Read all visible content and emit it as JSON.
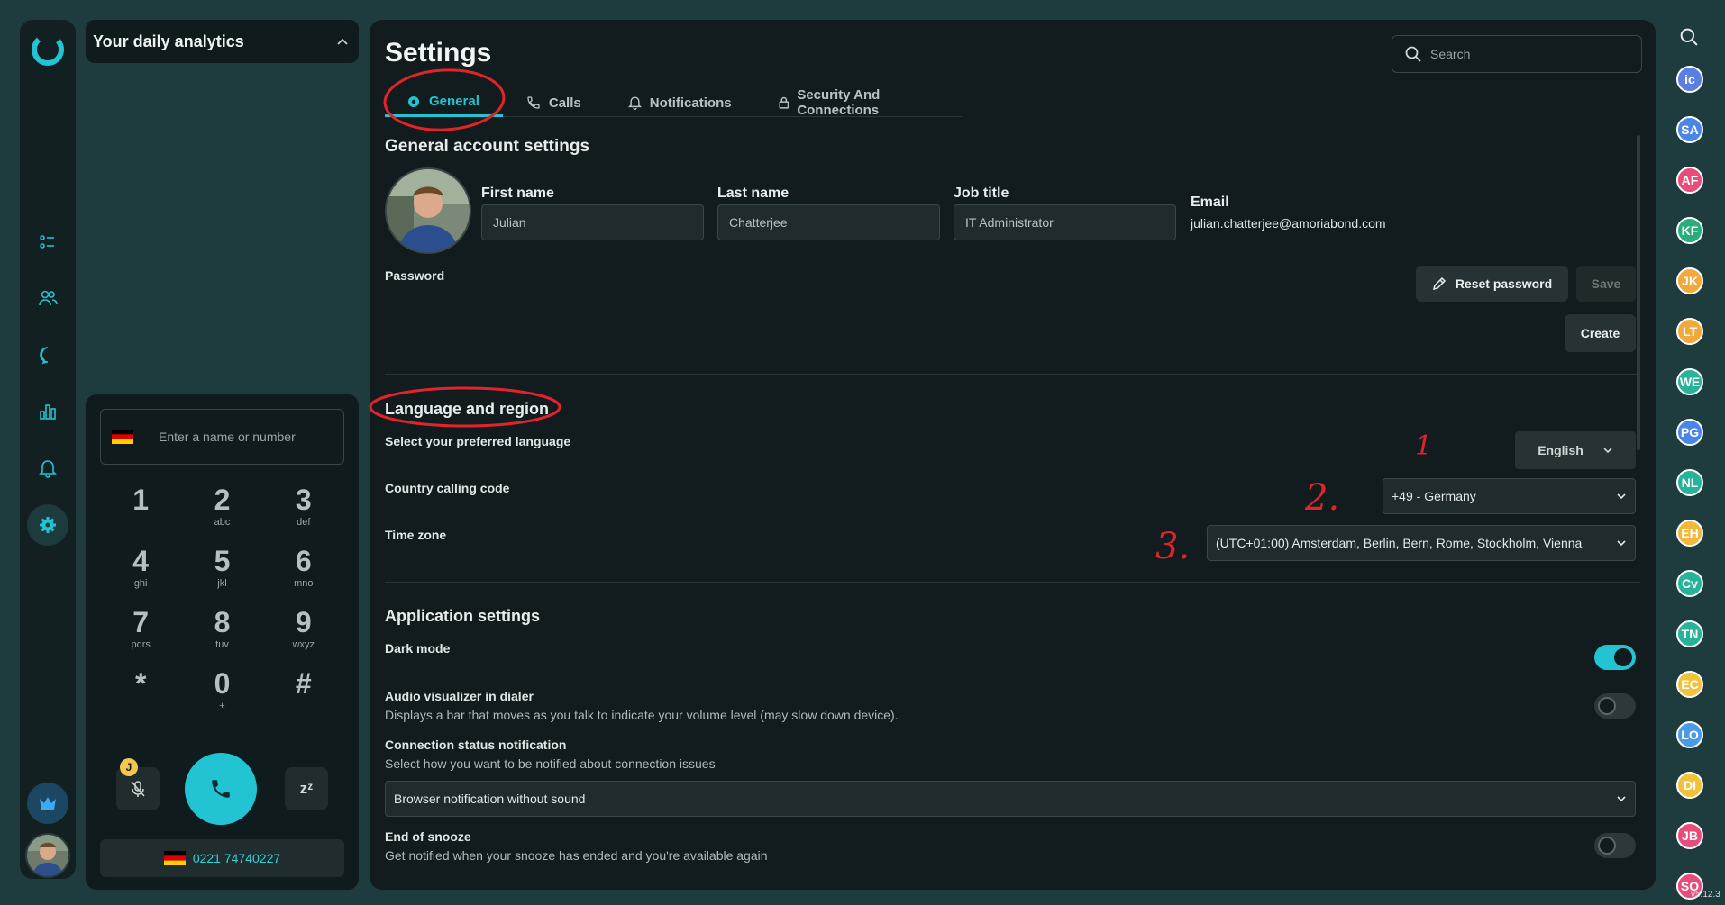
{
  "analytics": {
    "title": "Your daily analytics"
  },
  "dialer": {
    "placeholder": "Enter a name or number",
    "keys": [
      {
        "num": "1",
        "letters": ""
      },
      {
        "num": "2",
        "letters": "abc"
      },
      {
        "num": "3",
        "letters": "def"
      },
      {
        "num": "4",
        "letters": "ghi"
      },
      {
        "num": "5",
        "letters": "jkl"
      },
      {
        "num": "6",
        "letters": "mno"
      },
      {
        "num": "7",
        "letters": "pqrs"
      },
      {
        "num": "8",
        "letters": "tuv"
      },
      {
        "num": "9",
        "letters": "wxyz"
      },
      {
        "num": "*",
        "letters": ""
      },
      {
        "num": "0",
        "letters": "+"
      },
      {
        "num": "#",
        "letters": ""
      }
    ],
    "badge": "J",
    "snooze_label": "zᶻ",
    "my_number": "0221 74740227"
  },
  "settings": {
    "title": "Settings",
    "search_placeholder": "Search",
    "tabs": [
      {
        "label": "General",
        "icon": "gear-icon"
      },
      {
        "label": "Calls",
        "icon": "phone-icon"
      },
      {
        "label": "Notifications",
        "icon": "bell-icon"
      },
      {
        "label": "Security And Connections",
        "icon": "lock-icon"
      }
    ],
    "general": {
      "heading": "General account settings",
      "first_name_label": "First name",
      "first_name": "Julian",
      "last_name_label": "Last name",
      "last_name": "Chatterjee",
      "job_title_label": "Job title",
      "job_title": "IT Administrator",
      "email_label": "Email",
      "email": "julian.chatterjee@amoriabond.com",
      "password_label": "Password",
      "reset_password": "Reset password",
      "save": "Save",
      "create": "Create"
    },
    "language": {
      "heading": "Language and region",
      "language_label": "Select your preferred language",
      "language_value": "English",
      "country_label": "Country calling code",
      "country_value": "+49 - Germany",
      "timezone_label": "Time zone",
      "timezone_value": "(UTC+01:00) Amsterdam, Berlin, Bern, Rome, Stockholm, Vienna"
    },
    "app": {
      "heading": "Application settings",
      "dark_mode_label": "Dark mode",
      "dark_mode_on": true,
      "audio_label": "Audio visualizer in dialer",
      "audio_desc": "Displays a bar that moves as you talk to indicate your volume level (may slow down device).",
      "audio_on": false,
      "conn_label": "Connection status notification",
      "conn_desc": "Select how you want to be notified about connection issues",
      "conn_value": "Browser notification without sound",
      "snooze_label": "End of snooze",
      "snooze_desc": "Get notified when your snooze has ended and you're available again",
      "snooze_on": false
    }
  },
  "presence": [
    {
      "initials": "ic",
      "color": "#5b7fe0"
    },
    {
      "initials": "SA",
      "color": "#4a86e8"
    },
    {
      "initials": "AF",
      "color": "#e84d7a"
    },
    {
      "initials": "KF",
      "color": "#27ae7a"
    },
    {
      "initials": "JK",
      "color": "#f2a93b"
    },
    {
      "initials": "LT",
      "color": "#f2a93b"
    },
    {
      "initials": "WE",
      "color": "#27b39a"
    },
    {
      "initials": "PG",
      "color": "#4a86e8"
    },
    {
      "initials": "NL",
      "color": "#27b39a"
    },
    {
      "initials": "EH",
      "color": "#f2b73b"
    },
    {
      "initials": "Cv",
      "color": "#27b39a"
    },
    {
      "initials": "TN",
      "color": "#27b39a"
    },
    {
      "initials": "EC",
      "color": "#f2c23b"
    },
    {
      "initials": "LO",
      "color": "#4a9ae8"
    },
    {
      "initials": "DI",
      "color": "#f2c23b"
    },
    {
      "initials": "JB",
      "color": "#e84d7a"
    },
    {
      "initials": "SO",
      "color": "#e84d7a"
    }
  ],
  "annotations": [
    "1",
    "2.",
    "3."
  ],
  "version": "v5.12.3",
  "colors": {
    "accent": "#22c4d3",
    "annotation": "#e0242a"
  }
}
